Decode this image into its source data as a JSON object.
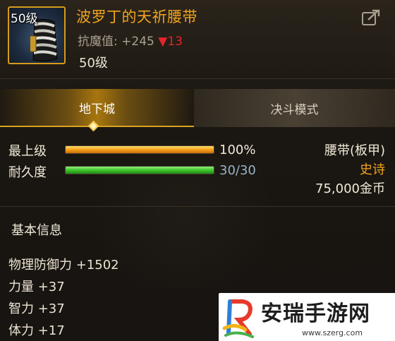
{
  "item": {
    "level_badge": "50级",
    "name": "波罗丁的天祈腰带",
    "stat_label": "抗魔值:",
    "stat_value": "+245",
    "stat_change": "▼13",
    "required_level": "50级"
  },
  "tabs": [
    {
      "label": "地下城",
      "active": true
    },
    {
      "label": "决斗模式",
      "active": false
    }
  ],
  "bars": {
    "grade": {
      "label": "最上级",
      "value_text": "100%",
      "fraction": 1.0
    },
    "durability": {
      "label": "耐久度",
      "value_text": "30/30",
      "fraction": 1.0
    }
  },
  "item_info": {
    "type": "腰带(板甲)",
    "rarity": "史诗",
    "price": "75,000金币"
  },
  "basic_info": {
    "title": "基本信息",
    "attributes": [
      "物理防御力 +1502",
      "力量 +37",
      "智力 +37",
      "体力 +17"
    ]
  },
  "watermark": {
    "title": "安瑞手游网",
    "url": "www.szerg.com"
  },
  "colors": {
    "item_name": "#f0a31e",
    "rarity": "#f0a31e",
    "stat_down": "#e4242a",
    "icon_border": "#d79a1c",
    "tab_active": "#a8760f"
  },
  "icons": {
    "share": "share-icon",
    "item": "belt-icon",
    "tab_marker": "diamond-icon",
    "watermark_logo": "logo-icon"
  }
}
